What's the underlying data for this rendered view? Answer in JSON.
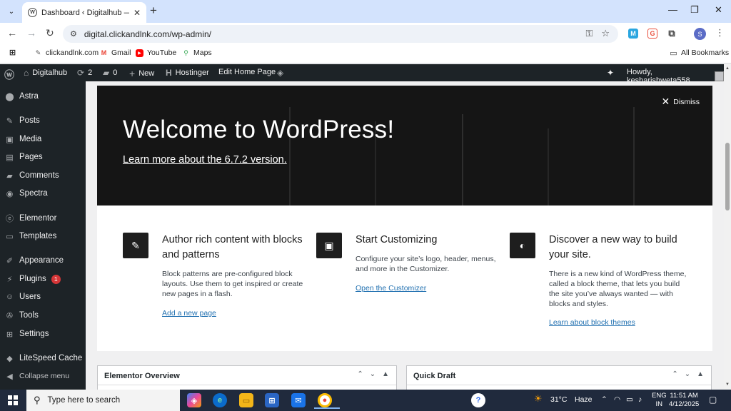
{
  "browser": {
    "tab_title": "Dashboard ‹ Digitalhub — Wor",
    "url": "digital.clickandlnk.com/wp-admin/",
    "profile_initial": "S",
    "bookmarks": [
      "clickandlnk.com",
      "Gmail",
      "YouTube",
      "Maps"
    ],
    "all_bookmarks": "All Bookmarks"
  },
  "adminbar": {
    "site_name": "Digitalhub",
    "updates": "2",
    "comments": "0",
    "new_label": "New",
    "hostinger": "Hostinger",
    "edit_home": "Edit Home Page",
    "howdy": "Howdy, kesharishweta558"
  },
  "sidebar": {
    "items": [
      {
        "label": "Astra"
      },
      {
        "label": "Posts"
      },
      {
        "label": "Media"
      },
      {
        "label": "Pages"
      },
      {
        "label": "Comments"
      },
      {
        "label": "Spectra"
      },
      {
        "label": "Elementor"
      },
      {
        "label": "Templates"
      },
      {
        "label": "Appearance"
      },
      {
        "label": "Plugins",
        "badge": "1"
      },
      {
        "label": "Users"
      },
      {
        "label": "Tools"
      },
      {
        "label": "Settings"
      },
      {
        "label": "LiteSpeed Cache"
      },
      {
        "label": "Collapse menu"
      }
    ]
  },
  "welcome": {
    "dismiss": "Dismiss",
    "title": "Welcome to WordPress!",
    "link": "Learn more about the 6.7.2 version."
  },
  "cards": [
    {
      "title": "Author rich content with blocks and patterns",
      "text": "Block patterns are pre-configured block layouts. Use them to get inspired or create new pages in a flash.",
      "link": "Add a new page"
    },
    {
      "title": "Start Customizing",
      "text": "Configure your site’s logo, header, menus, and more in the Customizer.",
      "link": "Open the Customizer"
    },
    {
      "title": "Discover a new way to build your site.",
      "text": "There is a new kind of WordPress theme, called a block theme, that lets you build the site you’ve always wanted — with blocks and styles.",
      "link": "Learn about block themes"
    }
  ],
  "widgets": {
    "left_title": "Elementor Overview",
    "right_title": "Quick Draft"
  },
  "taskbar": {
    "search_placeholder": "Type here to search",
    "temperature": "31°C",
    "weather": "Haze",
    "lang_top": "ENG",
    "lang_bottom": "IN",
    "time": "11:51 AM",
    "date": "4/12/2025"
  },
  "colors": {
    "wp_dark": "#1d2327",
    "link_blue": "#2271b1",
    "badge_red": "#d63638",
    "chrome_tabbar": "#d3e3fd",
    "taskbar": "#202a3d"
  }
}
